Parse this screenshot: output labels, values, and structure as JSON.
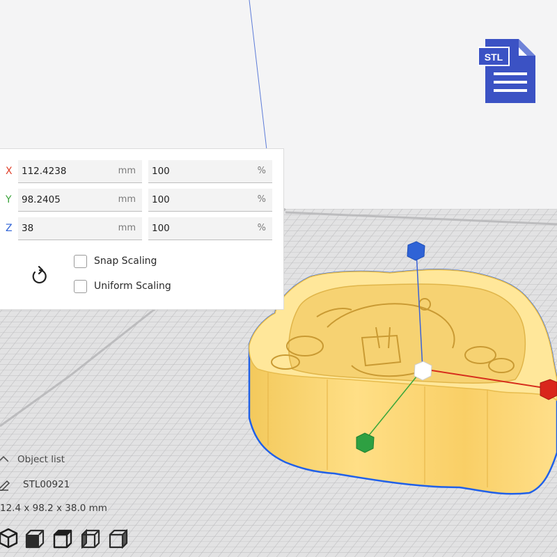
{
  "scale_panel": {
    "axes": [
      {
        "axis": "X",
        "color": "#e0412b",
        "size": "112.4238",
        "size_unit": "mm",
        "percent": "100",
        "percent_unit": "%"
      },
      {
        "axis": "Y",
        "color": "#3ca43c",
        "size": "98.2405",
        "size_unit": "mm",
        "percent": "100",
        "percent_unit": "%"
      },
      {
        "axis": "Z",
        "color": "#2f63d6",
        "size": "38",
        "size_unit": "mm",
        "percent": "100",
        "percent_unit": "%"
      }
    ],
    "reset_icon": "reset-icon",
    "snap_scaling": {
      "label": "Snap Scaling",
      "checked": false
    },
    "uniform_scaling": {
      "label": "Uniform Scaling",
      "checked": false
    }
  },
  "object_list": {
    "header": "Object list",
    "object_name": "STL00921",
    "dimensions": "12.4 x 98.2 x 38.0 mm"
  },
  "view_buttons": [
    "3d-view-icon",
    "front-view-icon",
    "top-view-icon",
    "left-view-icon",
    "right-view-icon"
  ],
  "badge": {
    "text": "STL",
    "color": "#3b52c4"
  },
  "model": {
    "color": "#ffd979",
    "outline": "#2060e8"
  }
}
